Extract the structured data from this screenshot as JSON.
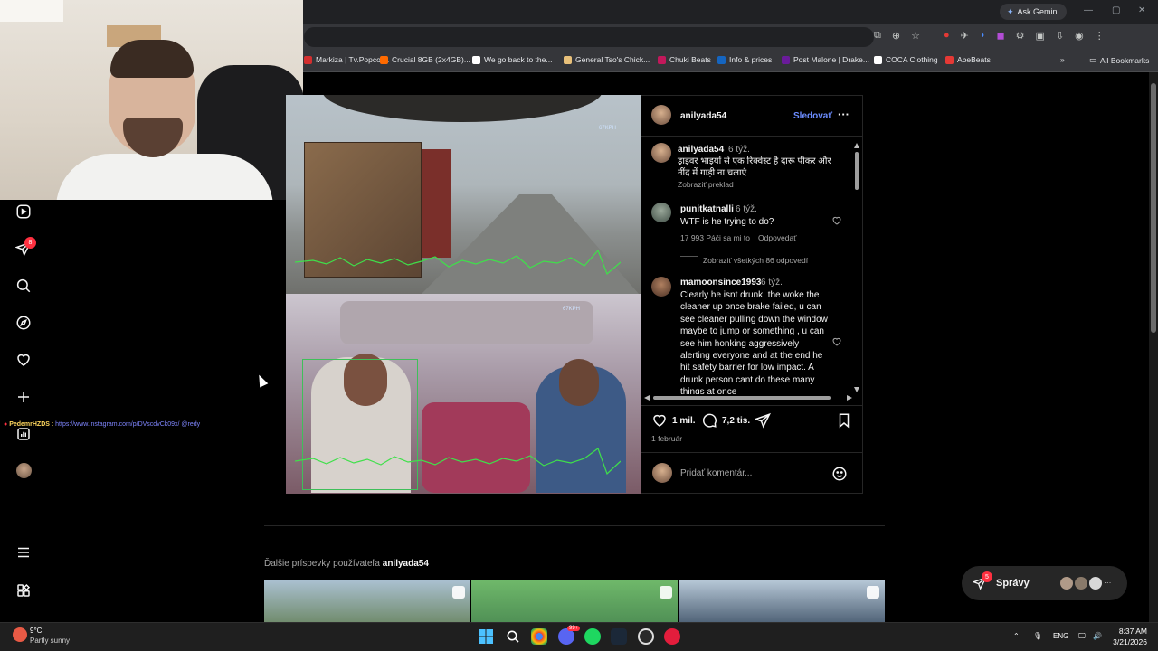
{
  "browser": {
    "ask_gemini": "Ask Gemini",
    "bookmarks": [
      {
        "label": "Markiza | Tv.Popcor...",
        "color": "#d32f2f"
      },
      {
        "label": "Crucial 8GB (2x4GB)...",
        "color": "#ff6a00"
      },
      {
        "label": "We go back to the...",
        "color": "#ffffff"
      },
      {
        "label": "General Tso's Chick...",
        "color": "#e8c07a"
      },
      {
        "label": "Chuki Beats",
        "color": "#c2185b"
      },
      {
        "label": "Info & prices",
        "color": "#1565c0"
      },
      {
        "label": "Post Malone | Drake...",
        "color": "#6a1b9a"
      },
      {
        "label": "COCA Clothing",
        "color": "#ffffff"
      },
      {
        "label": "AbeBeats",
        "color": "#e53935"
      }
    ],
    "all_bookmarks": "All Bookmarks"
  },
  "sidebar": {
    "notifications_badge": "8"
  },
  "chat_overlay": {
    "user": "PedemrHZDS :",
    "message": "https://www.instagram.com/p/DVscdvCk09x/ @redy"
  },
  "post": {
    "author": "anilyada54",
    "follow": "Sledovať",
    "caption_user": "anilyada54",
    "caption_time": "6 týž.",
    "caption_text": "ड्राइवर भाइयों से एक रिक्वेस्ट है दारू पीकर और नींद में गाड़ी ना चलाएं",
    "caption_translate": "Zobraziť preklad",
    "video_overlay": {
      "speed_top": "67KPH",
      "speed_bottom": "67KPH"
    },
    "comments": [
      {
        "user": "punitkatnalli",
        "time": "6 týž.",
        "text": "WTF is he trying to do?",
        "likes": "17 993 Páči sa mi to",
        "reply": "Odpovedať",
        "view_replies": "Zobraziť všetkých 86 odpovedí"
      },
      {
        "user": "mamoonsince1993",
        "time": "6 týž.",
        "text": "Clearly he isnt drunk, the woke the cleaner up once brake failed, u can see cleaner pulling down the window maybe to jump or something , u can see him honking aggressively alerting everyone and at the end he hit safety barrier for low impact. A drunk person cant do these many things at once"
      }
    ],
    "likes_count": "1 mil.",
    "comments_count": "7,2 tis.",
    "date": "1 február",
    "comment_placeholder": "Pridať komentár..."
  },
  "more_posts": {
    "prefix": "Ďalšie príspevky používateľa",
    "user": "anilyada54"
  },
  "messages": {
    "label": "Správy",
    "badge": "5",
    "more": "···"
  },
  "taskbar": {
    "temp": "9°C",
    "weather": "Partly sunny",
    "lang": "ENG",
    "time": "8:37 AM",
    "date": "3/21/2026",
    "discord_badge": "99+"
  }
}
